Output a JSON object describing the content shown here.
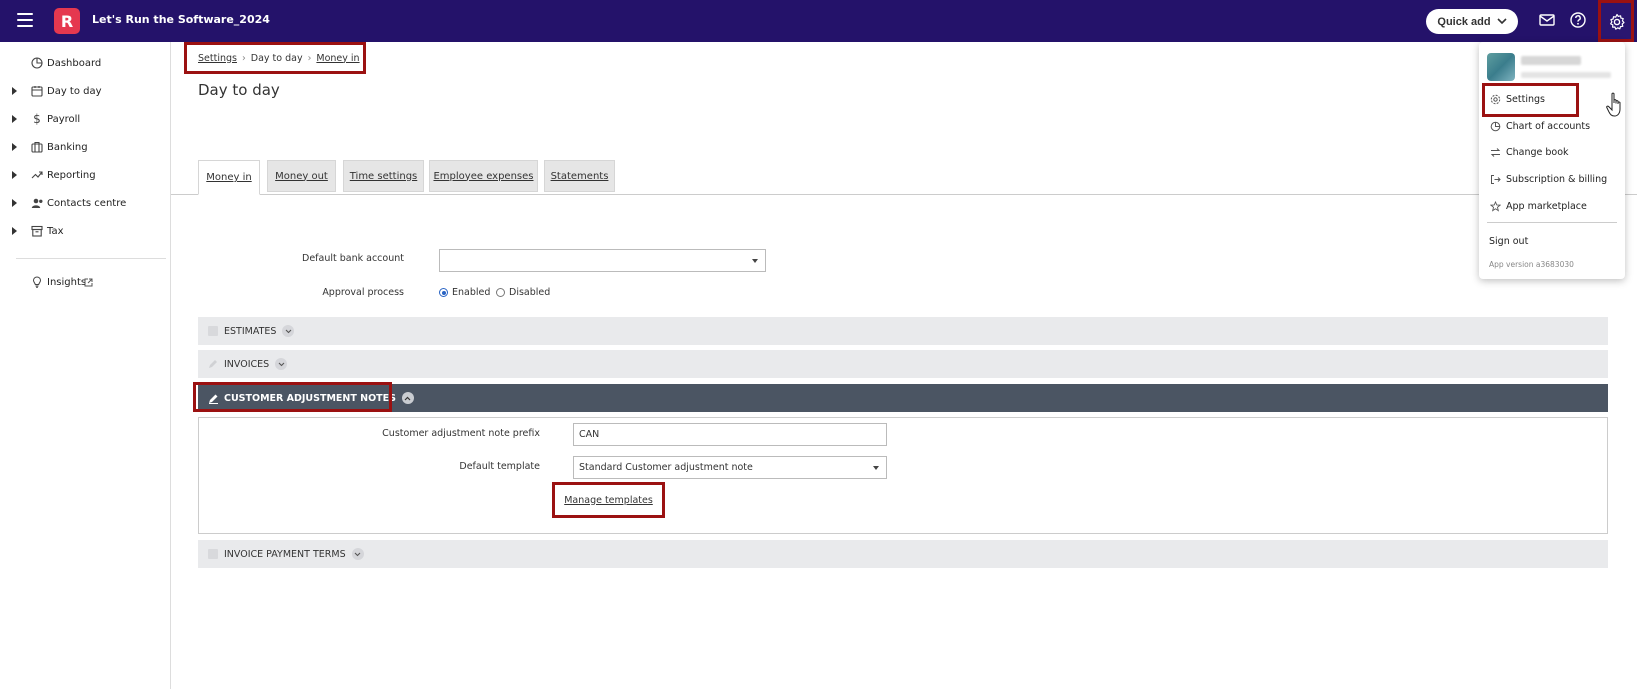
{
  "header": {
    "app_title": "Let's Run the Software_2024",
    "logo_letter": "R",
    "quick_add_label": "Quick add",
    "icons": [
      "menu-icon",
      "mail-icon",
      "help-icon",
      "gear-icon"
    ]
  },
  "sidebar": {
    "items": [
      {
        "label": "Dashboard",
        "icon": "dashboard-icon",
        "expandable": false
      },
      {
        "label": "Day to day",
        "icon": "calendar-icon",
        "expandable": true
      },
      {
        "label": "Payroll",
        "icon": "dollar-icon",
        "expandable": true
      },
      {
        "label": "Banking",
        "icon": "bank-icon",
        "expandable": true
      },
      {
        "label": "Reporting",
        "icon": "trend-icon",
        "expandable": true
      },
      {
        "label": "Contacts centre",
        "icon": "contacts-icon",
        "expandable": true
      },
      {
        "label": "Tax",
        "icon": "archive-icon",
        "expandable": true
      },
      {
        "label": "Insights",
        "icon": "lightbulb-icon",
        "expandable": false
      }
    ]
  },
  "breadcrumb": {
    "items": [
      "Settings",
      "Day to day",
      "Money in"
    ]
  },
  "page": {
    "title": "Day to day"
  },
  "tabs": [
    {
      "label": "Money in",
      "active": true
    },
    {
      "label": "Money out",
      "active": false
    },
    {
      "label": "Time settings",
      "active": false
    },
    {
      "label": "Employee expenses",
      "active": false
    },
    {
      "label": "Statements",
      "active": false
    }
  ],
  "form": {
    "default_bank_account_label": "Default bank account",
    "default_bank_account_value": "",
    "approval_process_label": "Approval process",
    "approval_enabled_label": "Enabled",
    "approval_disabled_label": "Disabled",
    "approval_selected": "Enabled"
  },
  "sections": {
    "estimates": "ESTIMATES",
    "invoices": "INVOICES",
    "customer_adjustment_notes": "CUSTOMER ADJUSTMENT NOTES",
    "invoice_payment_terms": "INVOICE PAYMENT TERMS"
  },
  "can_panel": {
    "prefix_label": "Customer adjustment note prefix",
    "prefix_value": "CAN",
    "template_label": "Default template",
    "template_value": "Standard Customer adjustment note",
    "manage_templates_label": "Manage templates"
  },
  "user_menu": {
    "items": [
      {
        "label": "Settings",
        "icon": "gear-icon"
      },
      {
        "label": "Chart of accounts",
        "icon": "pie-chart-icon"
      },
      {
        "label": "Change book",
        "icon": "swap-icon"
      },
      {
        "label": "Subscription & billing",
        "icon": "sign-out-arrow-icon"
      },
      {
        "label": "App marketplace",
        "icon": "star-icon"
      }
    ],
    "sign_out_label": "Sign out",
    "app_version": "App version a3683030"
  },
  "colors": {
    "topbar": "#24126a",
    "logo": "#e5384f",
    "highlight": "#9b1111",
    "section_dark": "#4b5563"
  }
}
